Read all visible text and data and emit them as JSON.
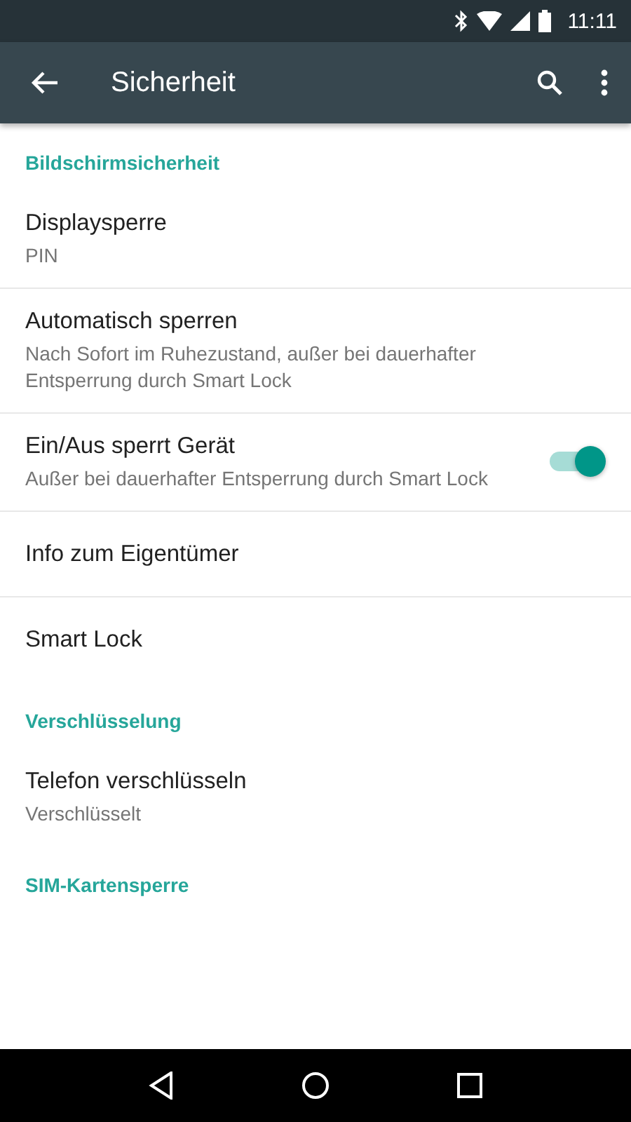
{
  "status_bar": {
    "time": "11:11"
  },
  "toolbar": {
    "title": "Sicherheit"
  },
  "sections": [
    {
      "header": "Bildschirmsicherheit",
      "items": [
        {
          "title": "Displaysperre",
          "summary": "PIN"
        },
        {
          "title": "Automatisch sperren",
          "summary": "Nach Sofort im Ruhezustand, außer bei dauerhafter Entsperrung durch Smart Lock"
        },
        {
          "title": "Ein/Aus sperrt Gerät",
          "summary": "Außer bei dauerhafter Entsperrung durch Smart Lock",
          "kind": "switch",
          "on": true
        },
        {
          "title": "Info zum Eigentümer"
        },
        {
          "title": "Smart Lock"
        }
      ]
    },
    {
      "header": "Verschlüsselung",
      "items": [
        {
          "title": "Telefon verschlüsseln",
          "summary": "Verschlüsselt"
        }
      ]
    },
    {
      "header": "SIM-Kartensperre"
    }
  ]
}
